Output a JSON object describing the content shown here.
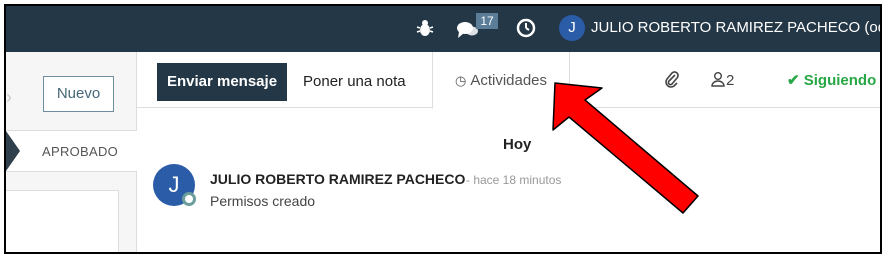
{
  "navbar": {
    "chat_badge": "17",
    "user_initial": "J",
    "user_name": "JULIO ROBERTO RAMIREZ PACHECO (odoo"
  },
  "left": {
    "new_button": "Nuevo",
    "status": "APROBADO"
  },
  "chatter": {
    "tabs": {
      "send_message": "Enviar mensaje",
      "log_note": "Poner una nota",
      "activities": "Actividades"
    },
    "followers_count": "2",
    "following_label": "Siguiendo",
    "day_separator": "Hoy",
    "message": {
      "avatar_initial": "J",
      "author": "JULIO ROBERTO RAMIREZ PACHECO",
      "time": "- hace 18 minutos",
      "body": "Permisos creado"
    }
  },
  "colors": {
    "navbar": "#233746",
    "avatar": "#2a5ca8",
    "following": "#28a745",
    "annotation_arrow": "#ff0000"
  },
  "icons": [
    "bug-icon",
    "chat-icon",
    "clock-icon",
    "paperclip-icon",
    "user-icon",
    "check-icon"
  ]
}
